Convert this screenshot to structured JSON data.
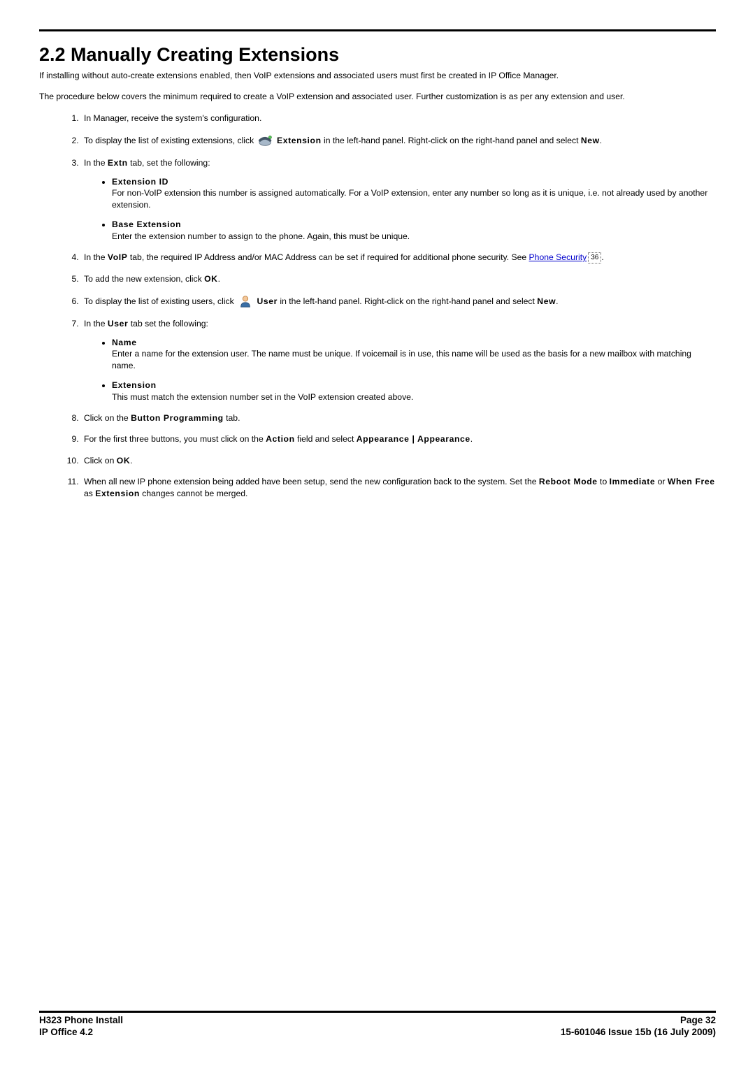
{
  "header": {
    "title": "2.2 Manually Creating Extensions"
  },
  "intro": {
    "p1": "If installing without auto-create extensions enabled, then VoIP extensions and associated users must first be created in IP Office Manager.",
    "p2": "The procedure below covers the minimum required to create a VoIP extension and associated user. Further customization is as per any extension and user."
  },
  "steps": {
    "s1": "In Manager, receive the system's configuration.",
    "s2a": "To display the list of existing extensions, click ",
    "s2b_bold": "Extension",
    "s2c": " in the left-hand panel. Right-click on the right-hand panel and select ",
    "s2d_bold": "New",
    "s2e": ".",
    "s3a": "In the ",
    "s3b_bold": "Extn",
    "s3c": " tab, set the following:",
    "s3_sub1_title": "Extension ID",
    "s3_sub1_body": "For non-VoIP extension this number is assigned automatically. For a VoIP extension, enter any number so long as it is unique, i.e. not already used by another extension.",
    "s3_sub2_title": "Base Extension",
    "s3_sub2_body": "Enter the extension number to assign to the phone. Again, this must be unique.",
    "s4a": "In the ",
    "s4b_bold": "VoIP",
    "s4c": " tab, the required IP Address and/or MAC Address can be set if required for additional phone security. See ",
    "s4_link": "Phone Security",
    "s4_ref": "36",
    "s4d": ".",
    "s5a": "To add the new extension, click ",
    "s5b_bold": "OK",
    "s5c": ".",
    "s6a": "To display the list of existing users, click ",
    "s6b_bold": "User",
    "s6c": " in the left-hand panel. Right-click on the right-hand panel and select ",
    "s6d_bold": "New",
    "s6e": ".",
    "s7a": "In the ",
    "s7b_bold": "User",
    "s7c": " tab set the following:",
    "s7_sub1_title": "Name",
    "s7_sub1_body": "Enter a name for the extension user. The name must be unique. If voicemail is in use, this name will be used as the basis for a new mailbox with matching name.",
    "s7_sub2_title": "Extension",
    "s7_sub2_body": "This must match the extension number set in the VoIP extension created above.",
    "s8a": "Click on the ",
    "s8b_bold": "Button Programming",
    "s8c": " tab.",
    "s9a": "For the first three buttons, you must click on the ",
    "s9b_bold": "Action",
    "s9c": " field and select ",
    "s9d_bold": "Appearance | Appearance",
    "s9e": ".",
    "s10a": "Click on ",
    "s10b_bold": "OK",
    "s10c": ".",
    "s11a": "When all new IP phone extension being added have been setup, send the new configuration back to the system. Set the ",
    "s11b_bold": "Reboot Mode",
    "s11c": " to ",
    "s11d_bold": "Immediate",
    "s11e": " or ",
    "s11f_bold": "When Free",
    "s11g": " as ",
    "s11h_bold": "Extension",
    "s11i": " changes cannot be merged."
  },
  "footer": {
    "left1": "H323 Phone Install",
    "left2": "IP Office 4.2",
    "right1": "Page 32",
    "right2": "15-601046 Issue 15b (16 July 2009)"
  }
}
